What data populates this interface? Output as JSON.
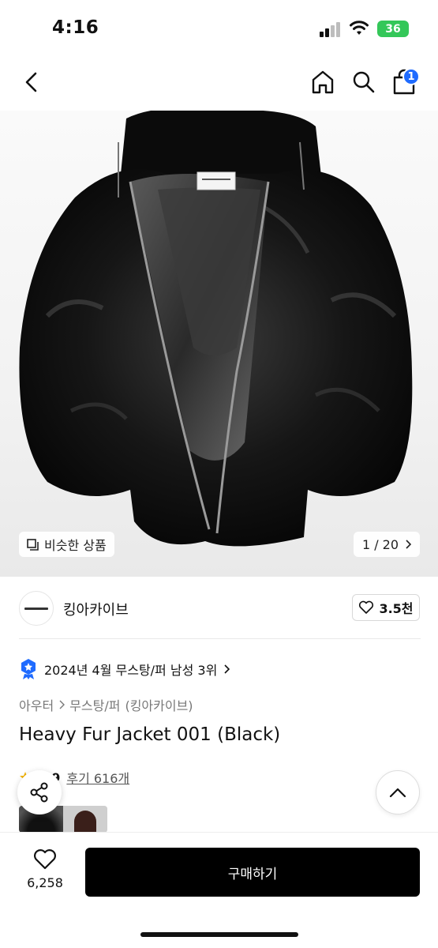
{
  "status_bar": {
    "time": "4:16",
    "battery": "36",
    "battery_color": "#34c759"
  },
  "nav": {
    "icons": [
      "back-icon",
      "home-icon",
      "search-icon",
      "cart-icon"
    ],
    "cart_badge": "1",
    "badge_color": "#1f6bff"
  },
  "hero": {
    "similar_label": "비슷한 상품",
    "page_indicator": "1 / 20"
  },
  "brand": {
    "name": "킹아카이브",
    "likes": "3.5천"
  },
  "ranking": {
    "text": "2024년 4월 무스탕/퍼 남성 3위"
  },
  "breadcrumb": {
    "items": [
      "아우터",
      "무스탕/퍼",
      "(킹아카이브)"
    ]
  },
  "product": {
    "title": "Heavy Fur Jacket 001 (Black)",
    "rating": "4.9",
    "reviews": "후기 616개"
  },
  "bottom_bar": {
    "wish_count": "6,258",
    "buy_label": "구매하기",
    "buy_color": "#000000"
  }
}
